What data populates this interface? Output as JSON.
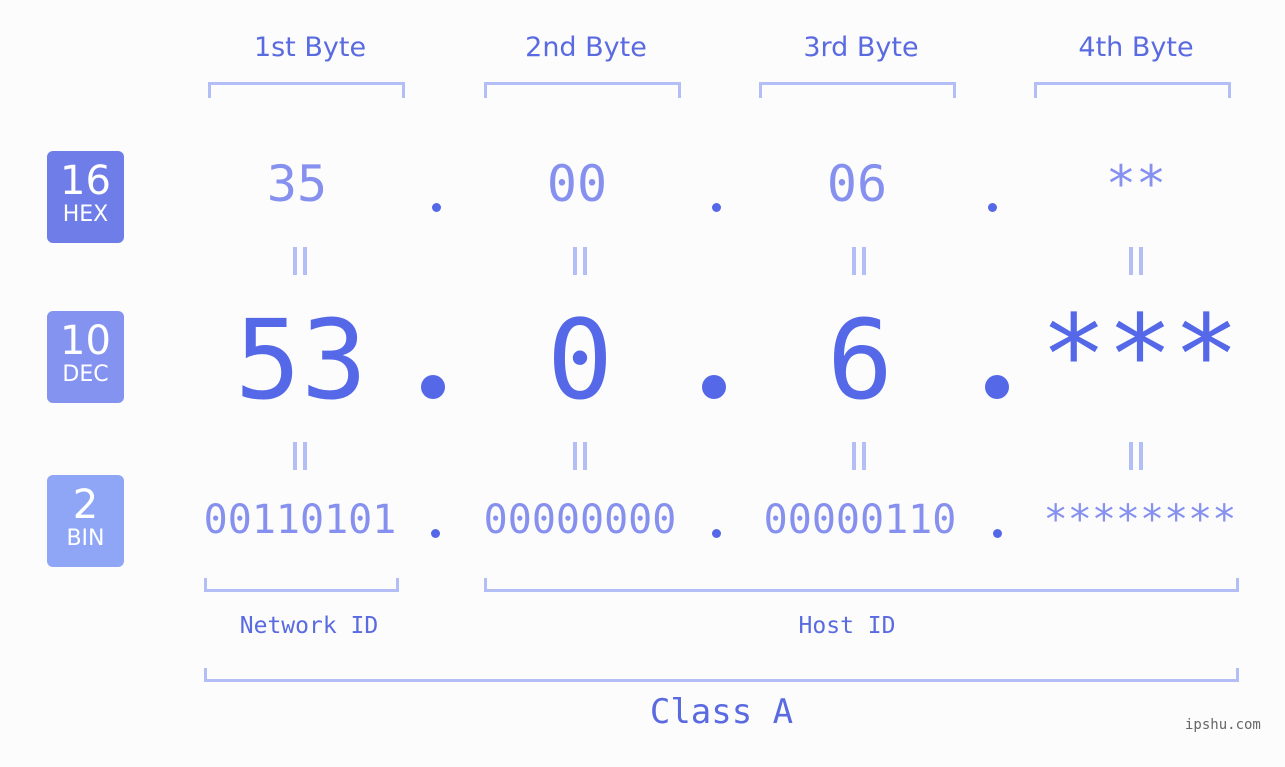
{
  "bytes": {
    "labels": [
      "1st Byte",
      "2nd Byte",
      "3rd Byte",
      "4th Byte"
    ]
  },
  "badges": {
    "hex": {
      "num": "16",
      "label": "HEX",
      "color": "#6f7de8"
    },
    "dec": {
      "num": "10",
      "label": "DEC",
      "color": "#8593f0"
    },
    "bin": {
      "num": "2",
      "label": "BIN",
      "color": "#8fa6f6"
    }
  },
  "values": {
    "hex": [
      "35",
      "00",
      "06",
      "**"
    ],
    "dec": [
      "53",
      "0",
      "6",
      "***"
    ],
    "bin": [
      "00110101",
      "00000000",
      "00000110",
      "********"
    ]
  },
  "separator": ".",
  "segments": {
    "network": "Network ID",
    "host": "Host ID",
    "class": "Class A"
  },
  "watermark": "ipshu.com",
  "colors": {
    "accent": "#5568e8",
    "light": "#8690ee",
    "bracket": "#b3bdf6"
  }
}
